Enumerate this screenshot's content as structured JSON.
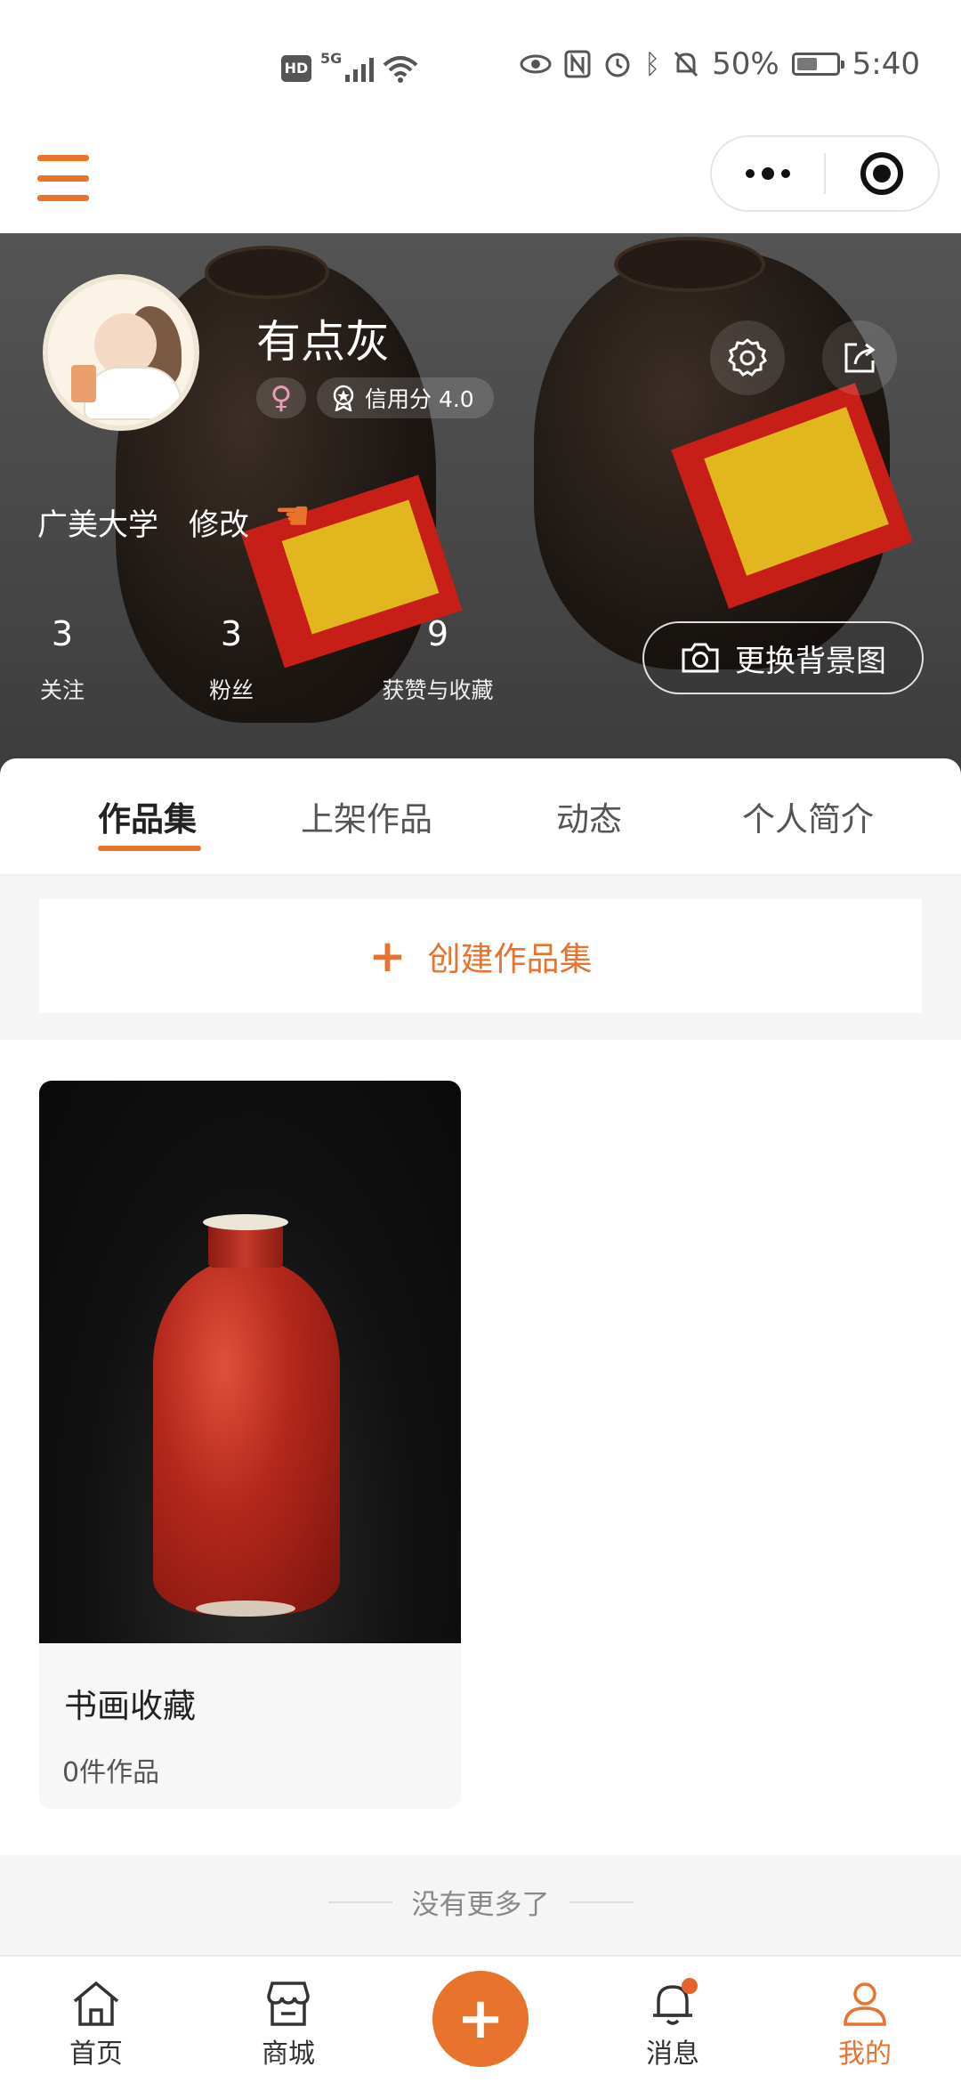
{
  "status_bar": {
    "hd": "HD",
    "signal_label": "5G",
    "battery": "50%",
    "time": "5:40"
  },
  "profile": {
    "username": "有点灰",
    "gender_symbol": "♀",
    "credit_label": "信用分 4.0",
    "school": "广美大学",
    "edit": "修改",
    "change_bg_label": "更换背景图",
    "stats": [
      {
        "value": "3",
        "label": "关注"
      },
      {
        "value": "3",
        "label": "粉丝"
      },
      {
        "value": "9",
        "label": "获赞与收藏"
      }
    ]
  },
  "tabs": [
    {
      "label": "作品集",
      "active": true
    },
    {
      "label": "上架作品",
      "active": false
    },
    {
      "label": "动态",
      "active": false
    },
    {
      "label": "个人简介",
      "active": false
    }
  ],
  "create_collection": {
    "plus": "+",
    "label": "创建作品集"
  },
  "collections": [
    {
      "title": "书画收藏",
      "count": "0件作品"
    }
  ],
  "footer": {
    "no_more": "没有更多了"
  },
  "tabbar": {
    "home": "首页",
    "mall": "商城",
    "plus": "+",
    "messages": "消息",
    "mine": "我的",
    "accent": "#e8732c"
  }
}
